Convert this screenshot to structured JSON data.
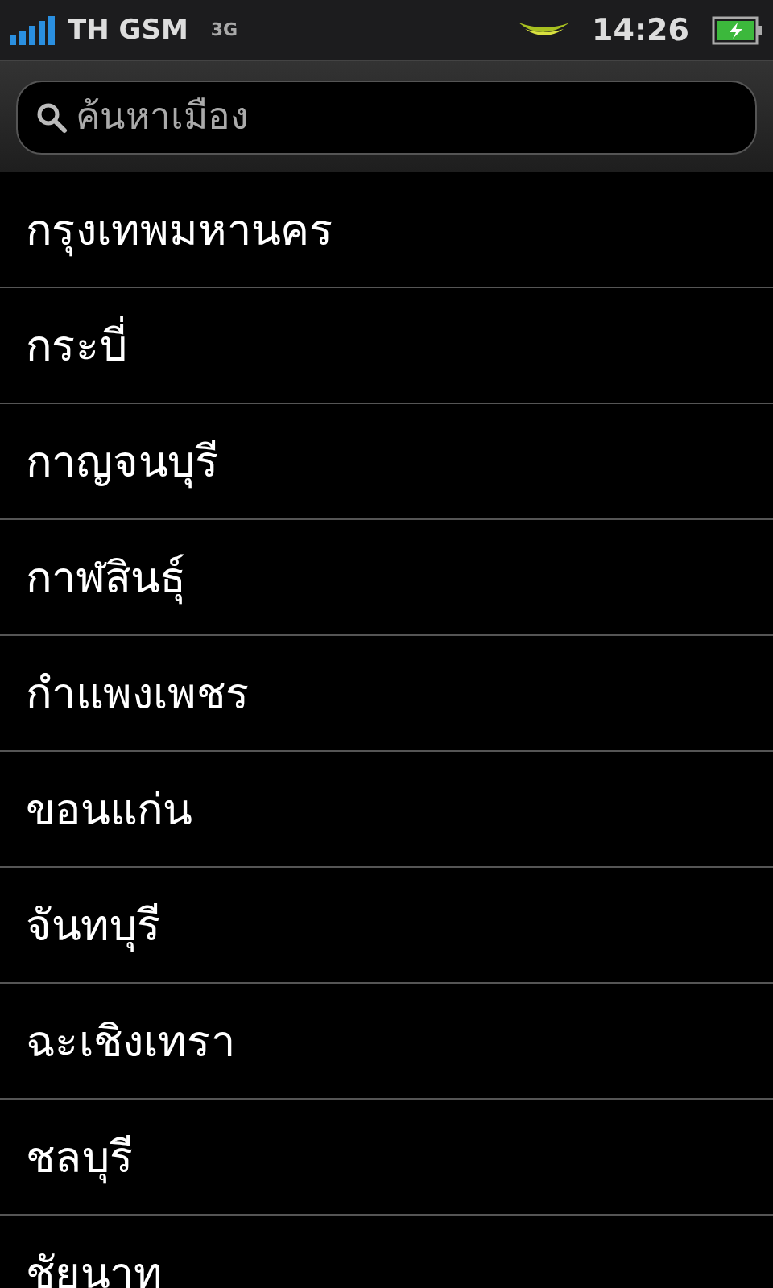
{
  "status_bar": {
    "carrier": "TH GSM",
    "network": "3G",
    "time": "14:26"
  },
  "search": {
    "placeholder": "ค้นหาเมือง"
  },
  "cities": [
    {
      "name": "กรุงเทพมหานคร"
    },
    {
      "name": "กระบี่"
    },
    {
      "name": "กาญจนบุรี"
    },
    {
      "name": "กาฬสินธุ์"
    },
    {
      "name": "กำแพงเพชร"
    },
    {
      "name": "ขอนแก่น"
    },
    {
      "name": "จันทบุรี"
    },
    {
      "name": "ฉะเชิงเทรา"
    },
    {
      "name": "ชลบุรี"
    },
    {
      "name": "ชัยนาท"
    }
  ]
}
